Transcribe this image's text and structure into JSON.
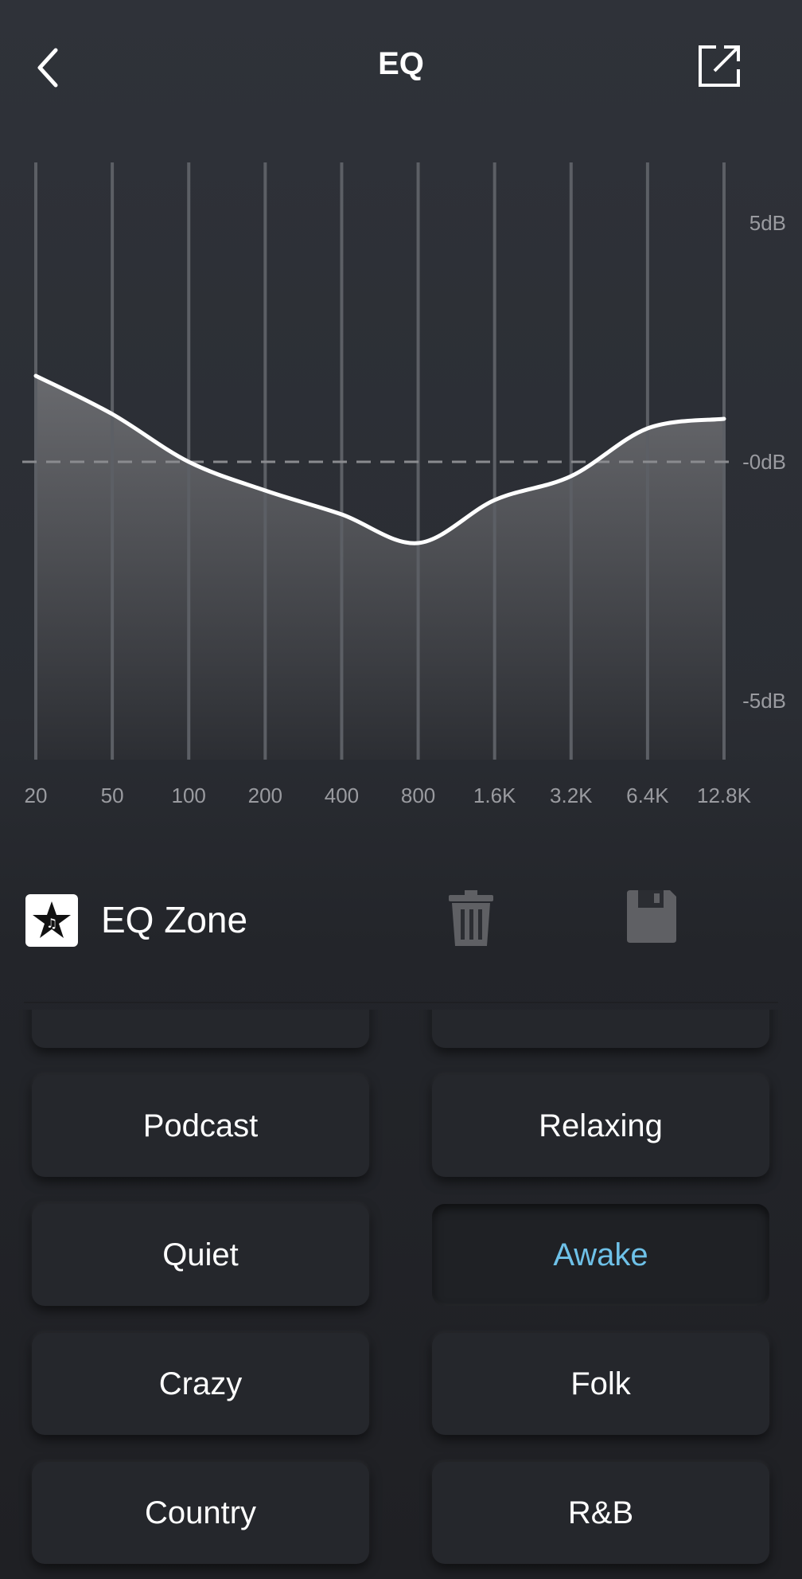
{
  "header": {
    "title": "EQ"
  },
  "chart_data": {
    "type": "line",
    "x": [
      "20",
      "50",
      "100",
      "200",
      "400",
      "800",
      "1.6K",
      "3.2K",
      "6.4K",
      "12.8K"
    ],
    "series": [
      {
        "values": [
          1.8,
          1.0,
          0.0,
          -0.6,
          -1.1,
          -1.7,
          -0.8,
          -0.3,
          0.7,
          0.9
        ]
      }
    ],
    "ylim": [
      -6.2,
      6.2
    ],
    "y_ticks": [
      "5dB",
      "0dB",
      "-5dB"
    ],
    "y_tick_values": [
      5,
      0,
      -5
    ],
    "reference_line": 0,
    "grid": true,
    "colors": {
      "line": "#ffffff",
      "grid": "#5c5f65",
      "fill_top": "#6c6d71",
      "fill_bottom": "#2c2e33"
    }
  },
  "zone": {
    "label": "EQ Zone",
    "logo_icon": "star-music-icon"
  },
  "actions": {
    "delete_icon": "trash-icon",
    "save_icon": "floppy-disk-icon"
  },
  "presets": [
    {
      "label": "Podcast",
      "active": false
    },
    {
      "label": "Relaxing",
      "active": false
    },
    {
      "label": "Quiet",
      "active": false
    },
    {
      "label": "Awake",
      "active": true
    },
    {
      "label": "Crazy",
      "active": false
    },
    {
      "label": "Folk",
      "active": false
    },
    {
      "label": "Country",
      "active": false
    },
    {
      "label": "R&B",
      "active": false
    }
  ],
  "colors": {
    "accent": "#6ec1e8",
    "background": "#2f3239"
  }
}
